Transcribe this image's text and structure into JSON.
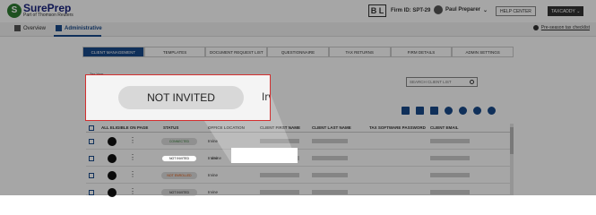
{
  "header": {
    "logo_mark": "S",
    "logo_name": "SurePrep",
    "logo_sub": "Part of Thomson Reuters",
    "firm_badge": "B L",
    "firm_id": "Firm ID: SPT-29",
    "user_name": "Paul Preparer",
    "help_label": "HELP CENTER",
    "taxaddy_label": "TAXCADDY"
  },
  "nav": {
    "items": [
      {
        "label": "Overview",
        "icon": "home-icon"
      },
      {
        "label": "Administrative",
        "icon": "admin-icon"
      }
    ],
    "checklist_label": "Pre-season tax checklist"
  },
  "tabs": [
    "CLIENT MANAGEMENT",
    "TEMPLATES",
    "DOCUMENT REQUEST LIST",
    "QUESTIONNAIRE",
    "TAX RETURNS",
    "FIRM DETAILS",
    "ADMIN SETTINGS"
  ],
  "active_tab": "CLIENT MANAGEMENT",
  "tax_year_label": "Tax Year",
  "search": {
    "placeholder": "SEARCH CLIENT LIST"
  },
  "toolbar_icons": [
    "excel-icon",
    "grid-icon",
    "columns-icon",
    "add-user-icon",
    "invite-user-icon",
    "remove-user-icon",
    "help-icon"
  ],
  "table": {
    "columns": [
      "ALL ELIGIBLE ON PAGE",
      "STATUS",
      "OFFICE LOCATION",
      "CLIENT FIRST NAME",
      "CLIENT LAST NAME",
      "TAX SOFTWARE PASSWORD",
      "CLIENT EMAIL"
    ],
    "rows": [
      {
        "status": "CONNECTED",
        "office": "Irvine",
        "status_color": "#2e7d32"
      },
      {
        "status": "NOT INVITED",
        "office": "Irvine",
        "status_color": "#222222"
      },
      {
        "status": "NOT ENROLLED",
        "office": "Irvine",
        "status_color": "#e65100"
      },
      {
        "status": "NOT INVITED",
        "office": "Irvine",
        "status_color": "#222222"
      }
    ]
  },
  "callout": {
    "status": "NOT INVITED",
    "trail": "Irv"
  },
  "colors": {
    "accent": "#1a4a8a",
    "highlight_border": "#d32f2f"
  }
}
